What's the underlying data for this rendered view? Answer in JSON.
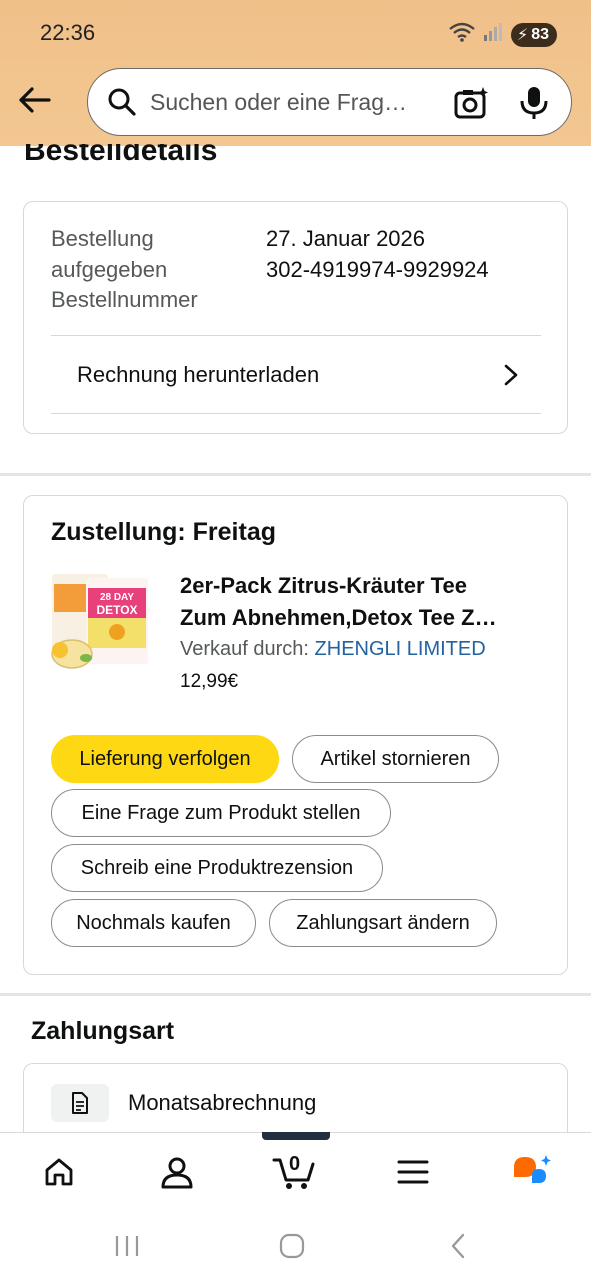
{
  "status_bar": {
    "time": "22:36",
    "battery": "83",
    "signal_label": "5"
  },
  "search": {
    "placeholder": "Suchen oder eine Frag…"
  },
  "page": {
    "title": "Bestelldetails"
  },
  "order_info": {
    "labels": [
      "Bestellung",
      "aufgegeben",
      "Bestellnummer"
    ],
    "date": "27. Januar 2026",
    "order_number": "302-4919974-9929924",
    "invoice_link": "Rechnung herunterladen"
  },
  "delivery": {
    "title": "Zustellung: Freitag",
    "product": {
      "title_line1": "2er-Pack Zitrus-Kräuter Tee",
      "title_line2": "Zum Abnehmen,Detox Tee Z…",
      "seller_prefix": "Verkauf durch: ",
      "seller_name": "ZHENGLI LIMITED",
      "price": "12,99€",
      "image_text": {
        "top": "28 DAY",
        "bottom": "DETOX"
      }
    },
    "actions": {
      "track": "Lieferung verfolgen",
      "cancel": "Artikel stornieren",
      "question": "Eine Frage zum Produkt stellen",
      "review": "Schreib eine Produktrezension",
      "buy_again": "Nochmals kaufen",
      "change_payment": "Zahlungsart ändern"
    }
  },
  "payment": {
    "title": "Zahlungsart",
    "method": "Monatsabrechnung"
  },
  "bottom_nav": {
    "cart_count": "0",
    "items": [
      "home-icon",
      "account-icon",
      "cart-icon",
      "menu-icon",
      "rufus-icon"
    ]
  },
  "colors": {
    "header_bg": "#f3c48e",
    "primary_button": "#ffd814",
    "link": "#2162a1",
    "nav_accent": "#232f3e",
    "rufus_orange": "#ff6a00",
    "rufus_blue": "#1a8cff"
  }
}
